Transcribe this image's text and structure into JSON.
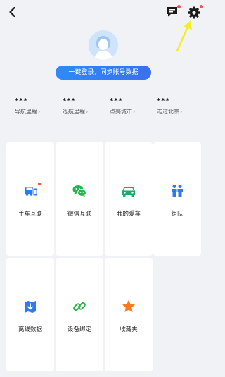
{
  "header": {
    "back_icon": "chevron-left-icon",
    "message_icon": "message-icon",
    "settings_icon": "gear-icon"
  },
  "profile": {
    "login_label": "一键登录，同步账号数据"
  },
  "stats": [
    {
      "value": "***",
      "label": "导航里程"
    },
    {
      "value": "***",
      "label": "巡航里程"
    },
    {
      "value": "***",
      "label": "点亮城市"
    },
    {
      "value": "***",
      "label": "走过北京"
    }
  ],
  "features": [
    {
      "label": "手车互联",
      "icon": "phone-car-icon"
    },
    {
      "label": "微信互联",
      "icon": "wechat-icon"
    },
    {
      "label": "我的爱车",
      "icon": "car-icon"
    },
    {
      "label": "组队",
      "icon": "team-icon"
    },
    {
      "label": "离线数据",
      "icon": "offline-download-icon"
    },
    {
      "label": "设备绑定",
      "icon": "link-icon"
    },
    {
      "label": "收藏夹",
      "icon": "star-icon"
    }
  ],
  "colors": {
    "background": "#f1f2f6",
    "accent_blue": "#2d7bf0",
    "wechat_green": "#27b44a",
    "car_green": "#1fa96a",
    "star_orange": "#ff7a1a",
    "badge_red": "#ff4d3a",
    "annotation_arrow": "#f2ee2a"
  }
}
